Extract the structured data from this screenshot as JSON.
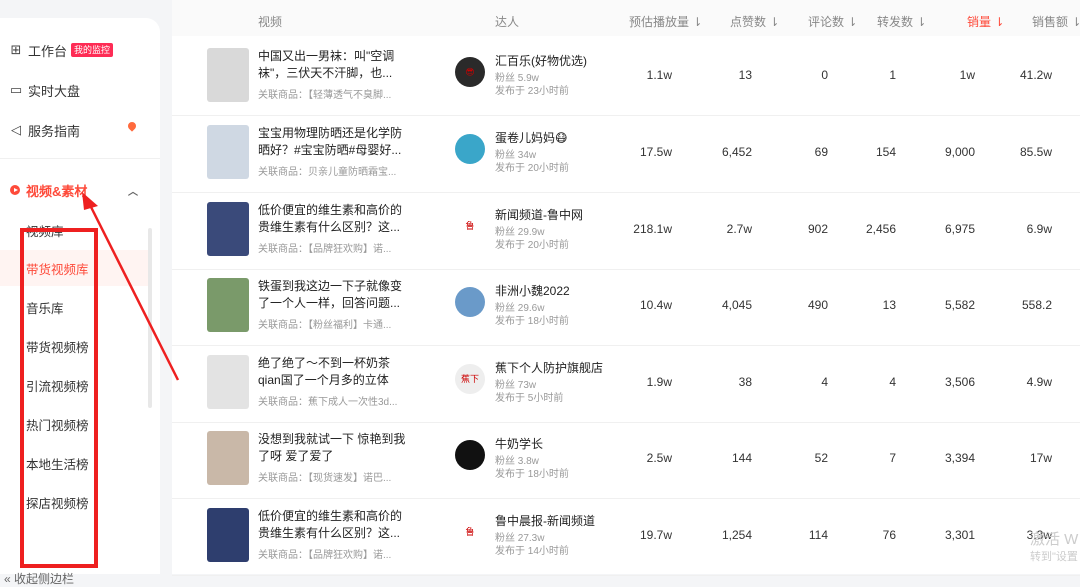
{
  "sidebar": {
    "workbench": {
      "label": "工作台",
      "badge": "我的监控"
    },
    "dashboard": {
      "label": "实时大盘"
    },
    "guide": {
      "label": "服务指南"
    },
    "section": {
      "label": "视频&素材"
    },
    "sub_items": [
      "视频库",
      "带货视频库",
      "音乐库",
      "带货视频榜",
      "引流视频榜",
      "热门视频榜",
      "本地生活榜",
      "探店视频榜"
    ],
    "collapse_label": "收起侧边栏"
  },
  "table": {
    "headers": {
      "video": "视频",
      "author": "达人",
      "plays": "预估播放量",
      "likes": "点赞数",
      "comments": "评论数",
      "shares": "转发数",
      "sales": "销量",
      "revenue": "销售额"
    },
    "related_prefix": "关联商品：",
    "rows": [
      {
        "title": "中国又出一男袜：叫\"空调袜\"，三伏天不汗脚，也...",
        "product": "【轻薄透气不臭脚...",
        "author": "汇百乐(好物优选)",
        "fans": "粉丝 5.9w",
        "posted": "发布于 23小时前",
        "plays": "1.1w",
        "likes": "13",
        "comments": "0",
        "shares": "1",
        "sales": "1w",
        "revenue": "41.2w"
      },
      {
        "title": "宝宝用物理防晒还是化学防晒好？#宝宝防晒#母婴好...",
        "product": "贝亲儿童防晒霜宝...",
        "author": "蛋卷儿妈妈😷",
        "fans": "粉丝 34w",
        "posted": "发布于 20小时前",
        "plays": "17.5w",
        "likes": "6,452",
        "comments": "69",
        "shares": "154",
        "sales": "9,000",
        "revenue": "85.5w"
      },
      {
        "title": "低价便宜的维生素和高价的贵维生素有什么区别？这...",
        "product": "【品牌狂欢购】诺...",
        "author": "新闻频道-鲁中网",
        "fans": "粉丝 29.9w",
        "posted": "发布于 20小时前",
        "plays": "218.1w",
        "likes": "2.7w",
        "comments": "902",
        "shares": "2,456",
        "sales": "6,975",
        "revenue": "6.9w"
      },
      {
        "title": "铁蛋到我这边一下子就像变了一个人一样，回答问题...",
        "product": "【粉丝福利】卡通...",
        "author": "非洲小魏2022",
        "fans": "粉丝 29.6w",
        "posted": "发布于 18小时前",
        "plays": "10.4w",
        "likes": "4,045",
        "comments": "490",
        "shares": "13",
        "sales": "5,582",
        "revenue": "558.2"
      },
      {
        "title": "绝了绝了～不到一杯奶茶qian国了一个月多的立体口...",
        "product": "蕉下成人一次性3d...",
        "author": "蕉下个人防护旗舰店",
        "fans": "粉丝 73w",
        "posted": "发布于 5小时前",
        "plays": "1.9w",
        "likes": "38",
        "comments": "4",
        "shares": "4",
        "sales": "3,506",
        "revenue": "4.9w"
      },
      {
        "title": "没想到我就试一下 惊艳到我了呀 爱了爱了",
        "product": "【现货速发】诺巴...",
        "author": "牛奶学长",
        "fans": "粉丝 3.8w",
        "posted": "发布于 18小时前",
        "plays": "2.5w",
        "likes": "144",
        "comments": "52",
        "shares": "7",
        "sales": "3,394",
        "revenue": "17w"
      },
      {
        "title": "低价便宜的维生素和高价的贵维生素有什么区别？这...",
        "product": "【品牌狂欢购】诺...",
        "author": "鲁中晨报-新闻频道",
        "fans": "粉丝 27.3w",
        "posted": "发布于 14小时前",
        "plays": "19.7w",
        "likes": "1,254",
        "comments": "114",
        "shares": "76",
        "sales": "3,301",
        "revenue": "3.3w"
      }
    ]
  },
  "watermark": {
    "line1": "激活 W",
    "line2": "转到\"设置"
  },
  "colors": {
    "accent": "#fe4a3a",
    "annotation": "#ee2020"
  }
}
